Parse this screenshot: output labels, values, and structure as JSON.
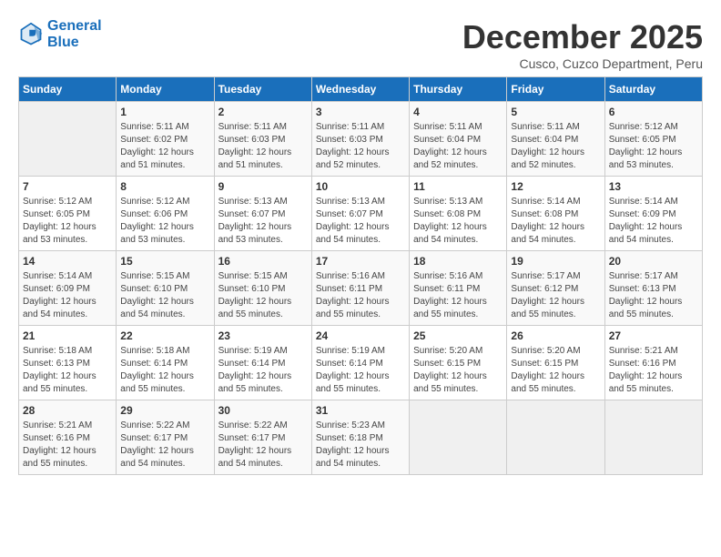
{
  "logo": {
    "line1": "General",
    "line2": "Blue"
  },
  "title": "December 2025",
  "subtitle": "Cusco, Cuzco Department, Peru",
  "days_of_week": [
    "Sunday",
    "Monday",
    "Tuesday",
    "Wednesday",
    "Thursday",
    "Friday",
    "Saturday"
  ],
  "weeks": [
    [
      {
        "day": "",
        "sunrise": "",
        "sunset": "",
        "daylight": ""
      },
      {
        "day": "1",
        "sunrise": "5:11 AM",
        "sunset": "6:02 PM",
        "daylight": "12 hours and 51 minutes."
      },
      {
        "day": "2",
        "sunrise": "5:11 AM",
        "sunset": "6:03 PM",
        "daylight": "12 hours and 51 minutes."
      },
      {
        "day": "3",
        "sunrise": "5:11 AM",
        "sunset": "6:03 PM",
        "daylight": "12 hours and 52 minutes."
      },
      {
        "day": "4",
        "sunrise": "5:11 AM",
        "sunset": "6:04 PM",
        "daylight": "12 hours and 52 minutes."
      },
      {
        "day": "5",
        "sunrise": "5:11 AM",
        "sunset": "6:04 PM",
        "daylight": "12 hours and 52 minutes."
      },
      {
        "day": "6",
        "sunrise": "5:12 AM",
        "sunset": "6:05 PM",
        "daylight": "12 hours and 53 minutes."
      }
    ],
    [
      {
        "day": "7",
        "sunrise": "5:12 AM",
        "sunset": "6:05 PM",
        "daylight": "12 hours and 53 minutes."
      },
      {
        "day": "8",
        "sunrise": "5:12 AM",
        "sunset": "6:06 PM",
        "daylight": "12 hours and 53 minutes."
      },
      {
        "day": "9",
        "sunrise": "5:13 AM",
        "sunset": "6:07 PM",
        "daylight": "12 hours and 53 minutes."
      },
      {
        "day": "10",
        "sunrise": "5:13 AM",
        "sunset": "6:07 PM",
        "daylight": "12 hours and 54 minutes."
      },
      {
        "day": "11",
        "sunrise": "5:13 AM",
        "sunset": "6:08 PM",
        "daylight": "12 hours and 54 minutes."
      },
      {
        "day": "12",
        "sunrise": "5:14 AM",
        "sunset": "6:08 PM",
        "daylight": "12 hours and 54 minutes."
      },
      {
        "day": "13",
        "sunrise": "5:14 AM",
        "sunset": "6:09 PM",
        "daylight": "12 hours and 54 minutes."
      }
    ],
    [
      {
        "day": "14",
        "sunrise": "5:14 AM",
        "sunset": "6:09 PM",
        "daylight": "12 hours and 54 minutes."
      },
      {
        "day": "15",
        "sunrise": "5:15 AM",
        "sunset": "6:10 PM",
        "daylight": "12 hours and 54 minutes."
      },
      {
        "day": "16",
        "sunrise": "5:15 AM",
        "sunset": "6:10 PM",
        "daylight": "12 hours and 55 minutes."
      },
      {
        "day": "17",
        "sunrise": "5:16 AM",
        "sunset": "6:11 PM",
        "daylight": "12 hours and 55 minutes."
      },
      {
        "day": "18",
        "sunrise": "5:16 AM",
        "sunset": "6:11 PM",
        "daylight": "12 hours and 55 minutes."
      },
      {
        "day": "19",
        "sunrise": "5:17 AM",
        "sunset": "6:12 PM",
        "daylight": "12 hours and 55 minutes."
      },
      {
        "day": "20",
        "sunrise": "5:17 AM",
        "sunset": "6:13 PM",
        "daylight": "12 hours and 55 minutes."
      }
    ],
    [
      {
        "day": "21",
        "sunrise": "5:18 AM",
        "sunset": "6:13 PM",
        "daylight": "12 hours and 55 minutes."
      },
      {
        "day": "22",
        "sunrise": "5:18 AM",
        "sunset": "6:14 PM",
        "daylight": "12 hours and 55 minutes."
      },
      {
        "day": "23",
        "sunrise": "5:19 AM",
        "sunset": "6:14 PM",
        "daylight": "12 hours and 55 minutes."
      },
      {
        "day": "24",
        "sunrise": "5:19 AM",
        "sunset": "6:14 PM",
        "daylight": "12 hours and 55 minutes."
      },
      {
        "day": "25",
        "sunrise": "5:20 AM",
        "sunset": "6:15 PM",
        "daylight": "12 hours and 55 minutes."
      },
      {
        "day": "26",
        "sunrise": "5:20 AM",
        "sunset": "6:15 PM",
        "daylight": "12 hours and 55 minutes."
      },
      {
        "day": "27",
        "sunrise": "5:21 AM",
        "sunset": "6:16 PM",
        "daylight": "12 hours and 55 minutes."
      }
    ],
    [
      {
        "day": "28",
        "sunrise": "5:21 AM",
        "sunset": "6:16 PM",
        "daylight": "12 hours and 55 minutes."
      },
      {
        "day": "29",
        "sunrise": "5:22 AM",
        "sunset": "6:17 PM",
        "daylight": "12 hours and 54 minutes."
      },
      {
        "day": "30",
        "sunrise": "5:22 AM",
        "sunset": "6:17 PM",
        "daylight": "12 hours and 54 minutes."
      },
      {
        "day": "31",
        "sunrise": "5:23 AM",
        "sunset": "6:18 PM",
        "daylight": "12 hours and 54 minutes."
      },
      {
        "day": "",
        "sunrise": "",
        "sunset": "",
        "daylight": ""
      },
      {
        "day": "",
        "sunrise": "",
        "sunset": "",
        "daylight": ""
      },
      {
        "day": "",
        "sunrise": "",
        "sunset": "",
        "daylight": ""
      }
    ]
  ]
}
